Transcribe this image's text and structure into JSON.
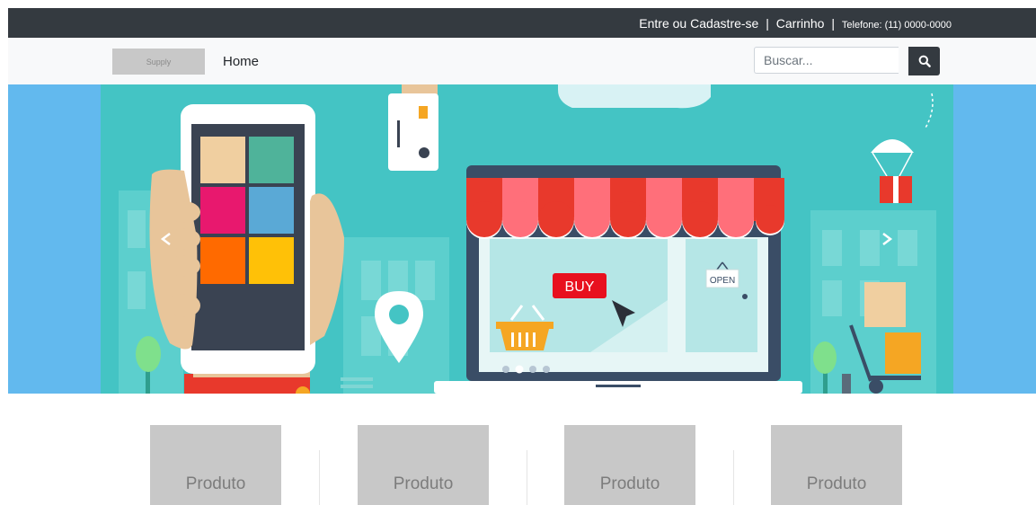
{
  "topbar": {
    "login_label": "Entre ou Cadastre-se",
    "separator": "|",
    "cart_label": "Carrinho",
    "phone_label": "Telefone: (11) 0000-0000"
  },
  "navbar": {
    "logo_text": "Supply",
    "home_label": "Home",
    "search_placeholder": "Buscar...",
    "search_icon": "search-icon"
  },
  "hero": {
    "buy_label": "BUY",
    "open_sign": "OPEN",
    "carousel_total": 4,
    "carousel_active": 2,
    "colors": {
      "side": "#62b9ee",
      "scene": "#44c4c4",
      "awning_red": "#e8392c",
      "awning_pink": "#ff6f7a"
    }
  },
  "products": [
    {
      "label": "Produto"
    },
    {
      "label": "Produto"
    },
    {
      "label": "Produto"
    },
    {
      "label": "Produto"
    }
  ]
}
